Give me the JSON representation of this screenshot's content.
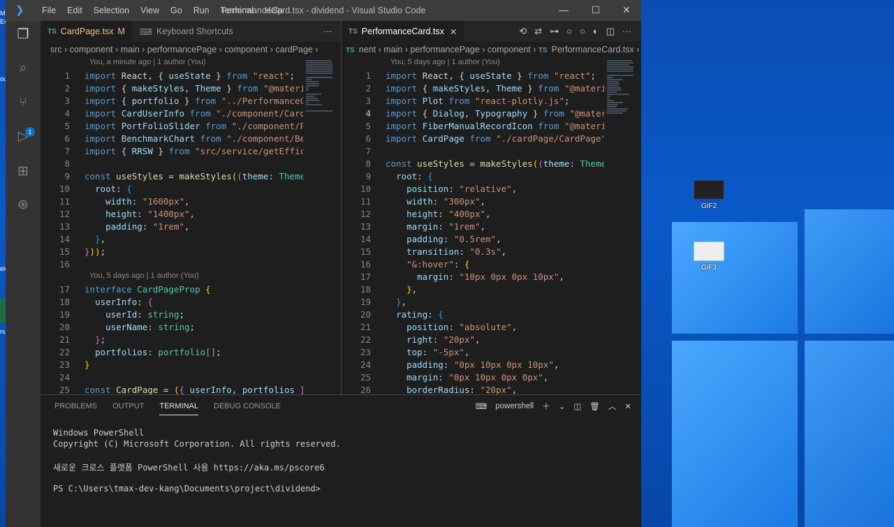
{
  "window_title": "PerformanceCard.tsx - dividend - Visual Studio Code",
  "menu": [
    "File",
    "Edit",
    "Selection",
    "View",
    "Go",
    "Run",
    "Terminal",
    "Help"
  ],
  "desktop": {
    "icons": [
      {
        "label": "GIF2"
      },
      {
        "label": "GIF3"
      }
    ],
    "left_fragments": [
      "Mic",
      "Ev",
      "ou",
      "ele",
      "nu"
    ]
  },
  "left_editor": {
    "tabs": [
      {
        "label": "CardPage.tsx",
        "badge": "M",
        "lang": "TS"
      },
      {
        "label": "Keyboard Shortcuts"
      }
    ],
    "tab_more": "···",
    "breadcrumb": "src › component › main › performancePage › component › cardPage › ",
    "blame_top": "You, a minute ago | 1 author (You)",
    "blame_mid": "You, 5 days ago | 1 author (You)",
    "lines": [
      {
        "n": "1",
        "tokens": [
          [
            "k",
            "import "
          ],
          [
            "p",
            "React, { "
          ],
          [
            "v",
            "useState"
          ],
          [
            "p",
            " } "
          ],
          [
            "k",
            "from "
          ],
          [
            "s",
            "\"react\""
          ],
          [
            "p",
            ";"
          ]
        ]
      },
      {
        "n": "2",
        "tokens": [
          [
            "k",
            "import "
          ],
          [
            "p",
            "{ "
          ],
          [
            "v",
            "makeStyles"
          ],
          [
            "p",
            ", "
          ],
          [
            "v",
            "Theme"
          ],
          [
            "p",
            " } "
          ],
          [
            "k",
            "from "
          ],
          [
            "s",
            "\"@materia"
          ]
        ]
      },
      {
        "n": "3",
        "tokens": [
          [
            "k",
            "import "
          ],
          [
            "p",
            "{ "
          ],
          [
            "v",
            "portfolio"
          ],
          [
            "p",
            " } "
          ],
          [
            "k",
            "from "
          ],
          [
            "s",
            "\"../PerformanceCo"
          ]
        ]
      },
      {
        "n": "4",
        "tokens": [
          [
            "k",
            "import "
          ],
          [
            "v",
            "CardUserInfo "
          ],
          [
            "k",
            "from "
          ],
          [
            "s",
            "\"./component/CardU"
          ]
        ]
      },
      {
        "n": "5",
        "tokens": [
          [
            "k",
            "import "
          ],
          [
            "v",
            "PortFolioSlider "
          ],
          [
            "k",
            "from "
          ],
          [
            "s",
            "\"./component/Po"
          ]
        ]
      },
      {
        "n": "6",
        "tokens": [
          [
            "k",
            "import "
          ],
          [
            "v",
            "BenchmarkChart "
          ],
          [
            "k",
            "from "
          ],
          [
            "s",
            "\"./component/Ben"
          ]
        ]
      },
      {
        "n": "7",
        "tokens": [
          [
            "k",
            "import "
          ],
          [
            "p",
            "{ "
          ],
          [
            "v",
            "RRSW"
          ],
          [
            "p",
            " } "
          ],
          [
            "k",
            "from "
          ],
          [
            "s",
            "\"src/service/getEffic"
          ]
        ]
      },
      {
        "n": "8",
        "tokens": []
      },
      {
        "n": "9",
        "tokens": [
          [
            "k",
            "const "
          ],
          [
            "f",
            "useStyles"
          ],
          [
            "p",
            " = "
          ],
          [
            "f",
            "makeStyles"
          ],
          [
            "y",
            "("
          ],
          [
            "pk",
            "("
          ],
          [
            "v",
            "theme"
          ],
          [
            "p",
            ": "
          ],
          [
            "t",
            "Theme"
          ]
        ]
      },
      {
        "n": "10",
        "tokens": [
          [
            "p",
            "  "
          ],
          [
            "v",
            "root"
          ],
          [
            "p",
            ": "
          ],
          [
            "bl",
            "{"
          ]
        ]
      },
      {
        "n": "11",
        "tokens": [
          [
            "p",
            "    "
          ],
          [
            "v",
            "width"
          ],
          [
            "p",
            ": "
          ],
          [
            "s",
            "\"1600px\""
          ],
          [
            "p",
            ","
          ]
        ]
      },
      {
        "n": "12",
        "tokens": [
          [
            "p",
            "    "
          ],
          [
            "v",
            "height"
          ],
          [
            "p",
            ": "
          ],
          [
            "s",
            "\"1400px\""
          ],
          [
            "p",
            ","
          ]
        ]
      },
      {
        "n": "13",
        "tokens": [
          [
            "p",
            "    "
          ],
          [
            "v",
            "padding"
          ],
          [
            "p",
            ": "
          ],
          [
            "s",
            "\"1rem\""
          ],
          [
            "p",
            ","
          ]
        ]
      },
      {
        "n": "14",
        "tokens": [
          [
            "p",
            "  "
          ],
          [
            "bl",
            "}"
          ],
          [
            "p",
            ","
          ]
        ]
      },
      {
        "n": "15",
        "tokens": [
          [
            "pk",
            "}"
          ],
          [
            "y",
            "))"
          ],
          [
            "p",
            ";"
          ]
        ]
      },
      {
        "n": "16",
        "tokens": []
      },
      {
        "n": "17",
        "tokens": [
          [
            "k",
            "interface "
          ],
          [
            "t",
            "CardPageProp"
          ],
          [
            "p",
            " "
          ],
          [
            "y",
            "{"
          ]
        ]
      },
      {
        "n": "18",
        "tokens": [
          [
            "p",
            "  "
          ],
          [
            "v",
            "userInfo"
          ],
          [
            "p",
            ": "
          ],
          [
            "pk",
            "{"
          ]
        ]
      },
      {
        "n": "19",
        "tokens": [
          [
            "p",
            "    "
          ],
          [
            "v",
            "userId"
          ],
          [
            "p",
            ": "
          ],
          [
            "t",
            "string"
          ],
          [
            "p",
            ";"
          ]
        ]
      },
      {
        "n": "20",
        "tokens": [
          [
            "p",
            "    "
          ],
          [
            "v",
            "userName"
          ],
          [
            "p",
            ": "
          ],
          [
            "t",
            "string"
          ],
          [
            "p",
            ";"
          ]
        ]
      },
      {
        "n": "21",
        "tokens": [
          [
            "p",
            "  "
          ],
          [
            "pk",
            "}"
          ],
          [
            "p",
            ";"
          ]
        ]
      },
      {
        "n": "22",
        "tokens": [
          [
            "p",
            "  "
          ],
          [
            "v",
            "portfolios"
          ],
          [
            "p",
            ": "
          ],
          [
            "t",
            "portfolio"
          ],
          [
            "pk",
            "[]"
          ],
          [
            "p",
            ";"
          ]
        ]
      },
      {
        "n": "23",
        "tokens": [
          [
            "y",
            "}"
          ]
        ]
      },
      {
        "n": "24",
        "tokens": []
      },
      {
        "n": "25",
        "tokens": [
          [
            "k",
            "const "
          ],
          [
            "f",
            "CardPage"
          ],
          [
            "p",
            " = "
          ],
          [
            "y",
            "("
          ],
          [
            "pk",
            "{ "
          ],
          [
            "v",
            "userInfo"
          ],
          [
            "p",
            ", "
          ],
          [
            "v",
            "portfolios"
          ],
          [
            "pk",
            " }"
          ]
        ]
      }
    ]
  },
  "right_editor": {
    "tabs": [
      {
        "label": "PerformanceCard.tsx",
        "lang": "TS"
      }
    ],
    "breadcrumb": "nent › main › performancePage › component › ",
    "breadcrumb_file": "PerformanceCard.tsx",
    "breadcrumb_more": "› ...",
    "blame_top": "You, 5 days ago | 1 author (You)",
    "current_line": "4",
    "lines": [
      {
        "n": "1",
        "tokens": [
          [
            "k",
            "import "
          ],
          [
            "p",
            "React, { "
          ],
          [
            "v",
            "useState"
          ],
          [
            "p",
            " } "
          ],
          [
            "k",
            "from "
          ],
          [
            "s",
            "\"react\""
          ],
          [
            "p",
            ";"
          ]
        ]
      },
      {
        "n": "2",
        "tokens": [
          [
            "k",
            "import "
          ],
          [
            "p",
            "{ "
          ],
          [
            "v",
            "makeStyles"
          ],
          [
            "p",
            ", "
          ],
          [
            "v",
            "Theme"
          ],
          [
            "p",
            " } "
          ],
          [
            "k",
            "from "
          ],
          [
            "s",
            "\"@materi"
          ]
        ]
      },
      {
        "n": "3",
        "tokens": [
          [
            "k",
            "import "
          ],
          [
            "v",
            "Plot "
          ],
          [
            "k",
            "from "
          ],
          [
            "s",
            "\"react-plotly.js\""
          ],
          [
            "p",
            ";"
          ]
        ]
      },
      {
        "n": "4",
        "tokens": [
          [
            "k",
            "import "
          ],
          [
            "p",
            "{ "
          ],
          [
            "v",
            "Dialog"
          ],
          [
            "p",
            ", "
          ],
          [
            "v",
            "Typography"
          ],
          [
            "p",
            " } "
          ],
          [
            "k",
            "from "
          ],
          [
            "s",
            "\"@mater"
          ]
        ]
      },
      {
        "n": "5",
        "tokens": [
          [
            "k",
            "import "
          ],
          [
            "v",
            "FiberManualRecordIcon "
          ],
          [
            "k",
            "from "
          ],
          [
            "s",
            "\"@materi"
          ]
        ]
      },
      {
        "n": "6",
        "tokens": [
          [
            "k",
            "import "
          ],
          [
            "v",
            "CardPage "
          ],
          [
            "k",
            "from "
          ],
          [
            "s",
            "\"./cardPage/CardPage\""
          ]
        ]
      },
      {
        "n": "7",
        "tokens": []
      },
      {
        "n": "8",
        "tokens": [
          [
            "k",
            "const "
          ],
          [
            "f",
            "useStyles"
          ],
          [
            "p",
            " = "
          ],
          [
            "f",
            "makeStyles"
          ],
          [
            "y",
            "("
          ],
          [
            "pk",
            "("
          ],
          [
            "v",
            "theme"
          ],
          [
            "p",
            ": "
          ],
          [
            "t",
            "Theme"
          ]
        ]
      },
      {
        "n": "9",
        "tokens": [
          [
            "p",
            "  "
          ],
          [
            "v",
            "root"
          ],
          [
            "p",
            ": "
          ],
          [
            "bl",
            "{"
          ]
        ]
      },
      {
        "n": "10",
        "tokens": [
          [
            "p",
            "    "
          ],
          [
            "v",
            "position"
          ],
          [
            "p",
            ": "
          ],
          [
            "s",
            "\"relative\""
          ],
          [
            "p",
            ","
          ]
        ]
      },
      {
        "n": "11",
        "tokens": [
          [
            "p",
            "    "
          ],
          [
            "v",
            "width"
          ],
          [
            "p",
            ": "
          ],
          [
            "s",
            "\"300px\""
          ],
          [
            "p",
            ","
          ]
        ]
      },
      {
        "n": "12",
        "tokens": [
          [
            "p",
            "    "
          ],
          [
            "v",
            "height"
          ],
          [
            "p",
            ": "
          ],
          [
            "s",
            "\"400px\""
          ],
          [
            "p",
            ","
          ]
        ]
      },
      {
        "n": "13",
        "tokens": [
          [
            "p",
            "    "
          ],
          [
            "v",
            "margin"
          ],
          [
            "p",
            ": "
          ],
          [
            "s",
            "\"1rem\""
          ],
          [
            "p",
            ","
          ]
        ]
      },
      {
        "n": "14",
        "tokens": [
          [
            "p",
            "    "
          ],
          [
            "v",
            "padding"
          ],
          [
            "p",
            ": "
          ],
          [
            "s",
            "\"0.5rem\""
          ],
          [
            "p",
            ","
          ]
        ]
      },
      {
        "n": "15",
        "tokens": [
          [
            "p",
            "    "
          ],
          [
            "v",
            "transition"
          ],
          [
            "p",
            ": "
          ],
          [
            "s",
            "\"0.3s\""
          ],
          [
            "p",
            ","
          ]
        ]
      },
      {
        "n": "16",
        "tokens": [
          [
            "p",
            "    "
          ],
          [
            "s",
            "\"&:hover\""
          ],
          [
            "p",
            ": "
          ],
          [
            "y",
            "{"
          ]
        ]
      },
      {
        "n": "17",
        "tokens": [
          [
            "p",
            "      "
          ],
          [
            "v",
            "margin"
          ],
          [
            "p",
            ": "
          ],
          [
            "s",
            "\"10px 0px 0px 10px\""
          ],
          [
            "p",
            ","
          ]
        ]
      },
      {
        "n": "18",
        "tokens": [
          [
            "p",
            "    "
          ],
          [
            "y",
            "}"
          ],
          [
            "p",
            ","
          ]
        ]
      },
      {
        "n": "19",
        "tokens": [
          [
            "p",
            "  "
          ],
          [
            "bl",
            "}"
          ],
          [
            "p",
            ","
          ]
        ]
      },
      {
        "n": "20",
        "tokens": [
          [
            "p",
            "  "
          ],
          [
            "v",
            "rating"
          ],
          [
            "p",
            ": "
          ],
          [
            "bl",
            "{"
          ]
        ]
      },
      {
        "n": "21",
        "tokens": [
          [
            "p",
            "    "
          ],
          [
            "v",
            "position"
          ],
          [
            "p",
            ": "
          ],
          [
            "s",
            "\"absolute\""
          ],
          [
            "p",
            ","
          ]
        ]
      },
      {
        "n": "22",
        "tokens": [
          [
            "p",
            "    "
          ],
          [
            "v",
            "right"
          ],
          [
            "p",
            ": "
          ],
          [
            "s",
            "\"20px\""
          ],
          [
            "p",
            ","
          ]
        ]
      },
      {
        "n": "23",
        "tokens": [
          [
            "p",
            "    "
          ],
          [
            "v",
            "top"
          ],
          [
            "p",
            ": "
          ],
          [
            "s",
            "\"-5px\""
          ],
          [
            "p",
            ","
          ]
        ]
      },
      {
        "n": "24",
        "tokens": [
          [
            "p",
            "    "
          ],
          [
            "v",
            "padding"
          ],
          [
            "p",
            ": "
          ],
          [
            "s",
            "\"0px 10px 0px 10px\""
          ],
          [
            "p",
            ","
          ]
        ]
      },
      {
        "n": "25",
        "tokens": [
          [
            "p",
            "    "
          ],
          [
            "v",
            "margin"
          ],
          [
            "p",
            ": "
          ],
          [
            "s",
            "\"0px 10px 0px 0px\""
          ],
          [
            "p",
            ","
          ]
        ]
      },
      {
        "n": "26",
        "tokens": [
          [
            "p",
            "    "
          ],
          [
            "v",
            "borderRadius"
          ],
          [
            "p",
            ": "
          ],
          [
            "s",
            "\"20px\""
          ],
          [
            "p",
            ","
          ]
        ]
      }
    ]
  },
  "panel": {
    "tabs": [
      "PROBLEMS",
      "OUTPUT",
      "TERMINAL",
      "DEBUG CONSOLE"
    ],
    "active_tab": "TERMINAL",
    "shell": "powershell",
    "terminal_lines": [
      "Windows PowerShell",
      "Copyright (C) Microsoft Corporation. All rights reserved.",
      "",
      "새로운 크로스 플랫폼 PowerShell 사용 https://aka.ms/pscore6",
      "",
      "PS C:\\Users\\tmax-dev-kang\\Documents\\project\\dividend>"
    ]
  },
  "colors": {
    "accent": "#0e70c0",
    "editor_bg": "#1e1e1e",
    "titlebar": "#3c3c3c",
    "activity": "#333333"
  }
}
